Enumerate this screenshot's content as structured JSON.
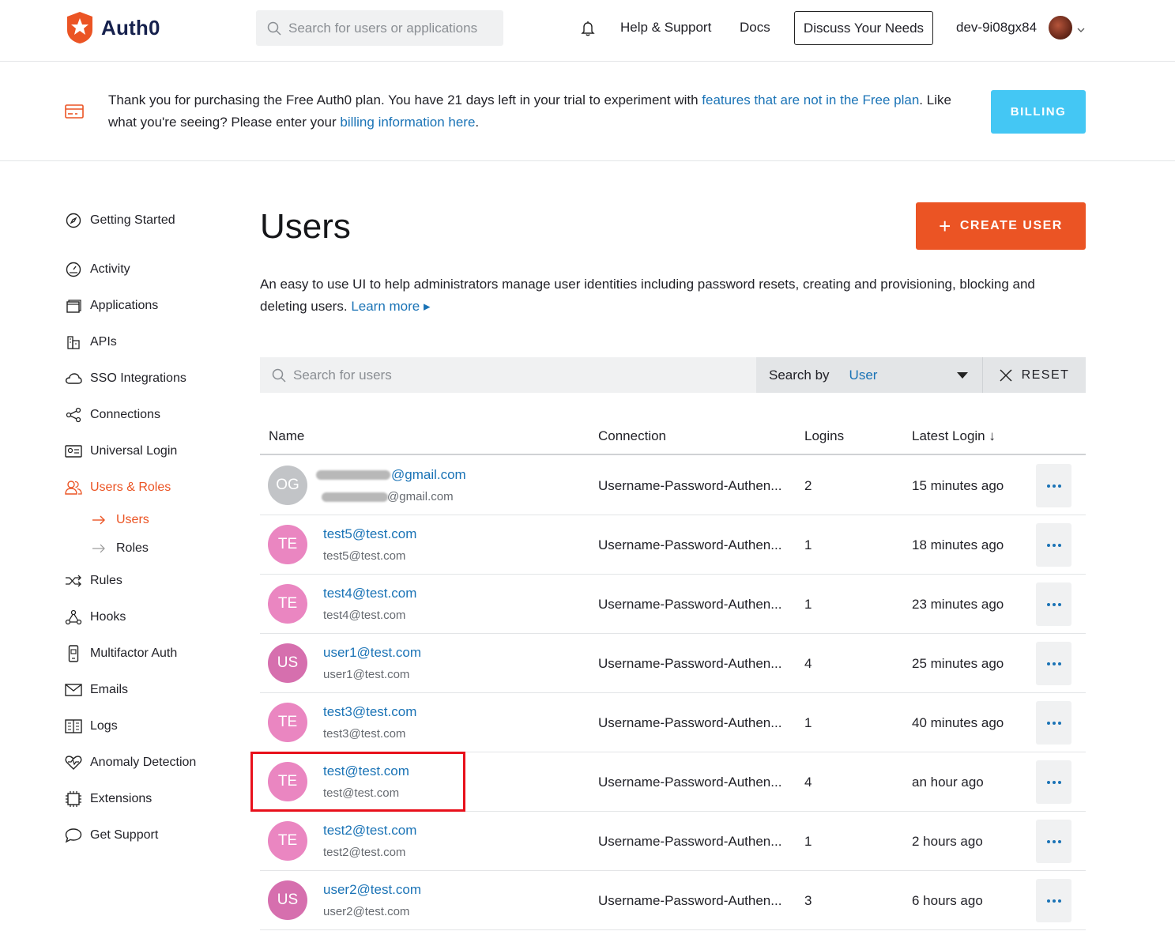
{
  "brand": {
    "name": "Auth0",
    "accent": "#eb5424"
  },
  "topnav": {
    "search_placeholder": "Search for users or applications",
    "help": "Help & Support",
    "docs": "Docs",
    "discuss": "Discuss Your Needs",
    "tenant": "dev-9i08gx84"
  },
  "banner": {
    "text_1": "Thank you for purchasing the Free Auth0 plan. You have 21 days left in your trial to experiment with ",
    "link_1": "features that are not in the Free plan",
    "text_2": ". Like what you're seeing? Please enter your ",
    "link_2": "billing information here",
    "text_3": ".",
    "button": "BILLING"
  },
  "sidebar": {
    "items": [
      {
        "label": "Getting Started",
        "icon": "compass-icon"
      },
      {
        "label": "Activity",
        "icon": "gauge-icon"
      },
      {
        "label": "Applications",
        "icon": "stack-icon"
      },
      {
        "label": "APIs",
        "icon": "building-icon"
      },
      {
        "label": "SSO Integrations",
        "icon": "cloud-icon"
      },
      {
        "label": "Connections",
        "icon": "share-icon"
      },
      {
        "label": "Universal Login",
        "icon": "id-card-icon"
      },
      {
        "label": "Users & Roles",
        "icon": "users-icon"
      },
      {
        "label": "Rules",
        "icon": "shuffle-icon"
      },
      {
        "label": "Hooks",
        "icon": "hooks-icon"
      },
      {
        "label": "Multifactor Auth",
        "icon": "phone-icon"
      },
      {
        "label": "Emails",
        "icon": "mail-icon"
      },
      {
        "label": "Logs",
        "icon": "book-icon"
      },
      {
        "label": "Anomaly Detection",
        "icon": "heartbeat-icon"
      },
      {
        "label": "Extensions",
        "icon": "chip-icon"
      },
      {
        "label": "Get Support",
        "icon": "chat-icon"
      }
    ],
    "sub": [
      {
        "label": "Users"
      },
      {
        "label": "Roles"
      }
    ]
  },
  "main": {
    "title": "Users",
    "create_button": "CREATE USER",
    "description": "An easy to use UI to help administrators manage user identities including password resets, creating and provisioning, blocking and deleting users.",
    "learn_more": "Learn more ▸",
    "search_placeholder": "Search for users",
    "search_by_label": "Search by",
    "search_by_value": "User",
    "reset": "RESET"
  },
  "table": {
    "columns": [
      "Name",
      "Connection",
      "Logins",
      "Latest Login ↓"
    ],
    "rows": [
      {
        "initials": "OG",
        "color": "#c2c4c7",
        "name": "@gmail.com",
        "email": "@gmail.com",
        "connection": "Username-Password-Authen...",
        "logins": "2",
        "last": "15 minutes ago"
      },
      {
        "initials": "TE",
        "color": "#ea86c1",
        "name": "test5@test.com",
        "email": "test5@test.com",
        "connection": "Username-Password-Authen...",
        "logins": "1",
        "last": "18 minutes ago"
      },
      {
        "initials": "TE",
        "color": "#ea86c1",
        "name": "test4@test.com",
        "email": "test4@test.com",
        "connection": "Username-Password-Authen...",
        "logins": "1",
        "last": "23 minutes ago"
      },
      {
        "initials": "US",
        "color": "#d66fae",
        "name": "user1@test.com",
        "email": "user1@test.com",
        "connection": "Username-Password-Authen...",
        "logins": "4",
        "last": "25 minutes ago"
      },
      {
        "initials": "TE",
        "color": "#ea86c1",
        "name": "test3@test.com",
        "email": "test3@test.com",
        "connection": "Username-Password-Authen...",
        "logins": "1",
        "last": "40 minutes ago"
      },
      {
        "initials": "TE",
        "color": "#ea86c1",
        "name": "test@test.com",
        "email": "test@test.com",
        "connection": "Username-Password-Authen...",
        "logins": "4",
        "last": "an hour ago"
      },
      {
        "initials": "TE",
        "color": "#ea86c1",
        "name": "test2@test.com",
        "email": "test2@test.com",
        "connection": "Username-Password-Authen...",
        "logins": "1",
        "last": "2 hours ago"
      },
      {
        "initials": "US",
        "color": "#d66fae",
        "name": "user2@test.com",
        "email": "user2@test.com",
        "connection": "Username-Password-Authen...",
        "logins": "3",
        "last": "6 hours ago"
      }
    ]
  }
}
